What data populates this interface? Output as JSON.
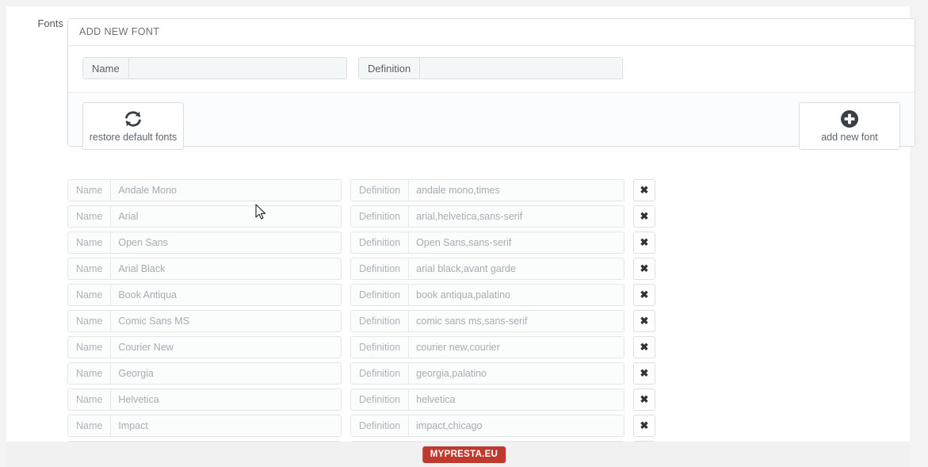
{
  "form_label": "Fonts",
  "panel": {
    "title": "ADD NEW FONT",
    "new_font": {
      "name_label": "Name",
      "name_value": "",
      "name_placeholder": "",
      "definition_label": "Definition",
      "definition_value": "",
      "definition_placeholder": ""
    },
    "actions": {
      "restore_label": "restore default fonts",
      "restore_icon": "refresh-icon",
      "add_label": "add new font",
      "add_icon": "plus-circle-icon"
    }
  },
  "table": {
    "name_label": "Name",
    "definition_label": "Definition",
    "delete_icon": "close-x-icon",
    "rows": [
      {
        "name": "Andale Mono",
        "definition": "andale mono,times"
      },
      {
        "name": "Arial",
        "definition": "arial,helvetica,sans-serif"
      },
      {
        "name": "Open Sans",
        "definition": "Open Sans,sans-serif"
      },
      {
        "name": "Arial Black",
        "definition": "arial black,avant garde"
      },
      {
        "name": "Book Antiqua",
        "definition": "book antiqua,palatino"
      },
      {
        "name": "Comic Sans MS",
        "definition": "comic sans ms,sans-serif"
      },
      {
        "name": "Courier New",
        "definition": "courier new,courier"
      },
      {
        "name": "Georgia",
        "definition": "georgia,palatino"
      },
      {
        "name": "Helvetica",
        "definition": "helvetica"
      },
      {
        "name": "Impact",
        "definition": "impact,chicago"
      },
      {
        "name": "",
        "definition": ""
      }
    ]
  },
  "footer": {
    "badge": "MYPRESTA.EU"
  },
  "colors": {
    "badge_bg": "#c0392f",
    "page_bg": "#f1f1f1",
    "sheet_bg": "#ffffff",
    "panel_border": "#dbdbdb",
    "input_bg": "#f4f7f8"
  }
}
